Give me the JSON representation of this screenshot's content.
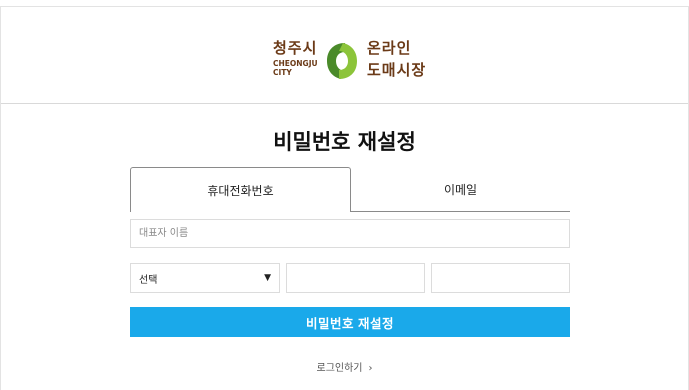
{
  "header": {
    "brand_ko": "청주시",
    "brand_en_line1": "CHEONGJU",
    "brand_en_line2": "CITY",
    "service_line1": "온라인",
    "service_line2": "도매시장",
    "logo_colors": {
      "green_dark": "#4a8a2a",
      "green_light": "#8cc43a",
      "text_brown": "#6b3a17"
    }
  },
  "page": {
    "title": "비밀번호 재설정"
  },
  "tabs": [
    {
      "label": "휴대전화번호",
      "active": true
    },
    {
      "label": "이메일",
      "active": false
    }
  ],
  "form": {
    "name_placeholder": "대표자 이름",
    "carrier_value": "선택",
    "submit_label": "비밀번호 재설정",
    "submit_color": "#1aa9ea"
  },
  "footer": {
    "login_link": "로그인하기",
    "login_arrow_icon": "chevron-right-icon"
  }
}
